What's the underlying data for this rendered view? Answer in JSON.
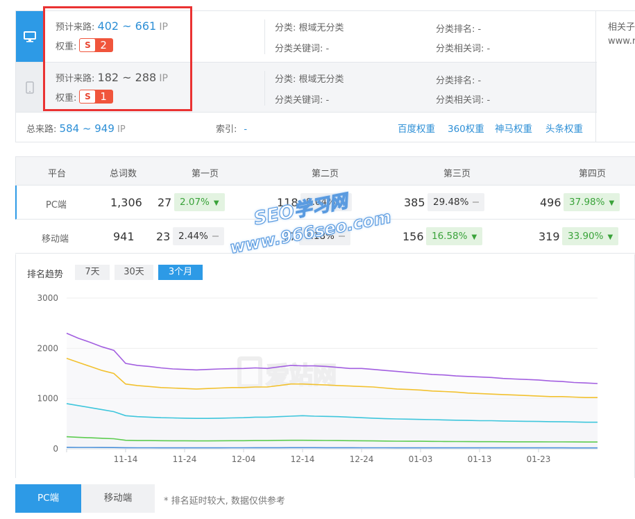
{
  "traffic": {
    "pc": {
      "estimate_label": "预计来路:",
      "range": "402 ~ 661",
      "unit": "IP",
      "weight_label": "权重:",
      "weight": "2",
      "category": "分类: 根域无分类",
      "category_keywords": "分类关键词: -",
      "category_rank": "分类排名: -",
      "category_related": "分类相关词: -"
    },
    "mobile": {
      "estimate_label": "预计来路:",
      "range": "182 ~ 288",
      "unit": "IP",
      "weight_label": "权重:",
      "weight": "1",
      "category": "分类: 根域无分类",
      "category_keywords": "分类关键词: -",
      "category_rank": "分类排名: -",
      "category_related": "分类相关词: -"
    },
    "total_label": "总来路:",
    "total_range": "584 ~ 949",
    "total_unit": "IP",
    "index_label": "索引:",
    "index_value": "-",
    "links": [
      "百度权重",
      "360权重",
      "神马权重",
      "头条权重"
    ],
    "side_label": "相关子",
    "side_value": "www.r"
  },
  "table": {
    "headers": [
      "平台",
      "总词数",
      "第一页",
      "第二页",
      "第三页",
      "第四页"
    ],
    "rows": [
      {
        "platform": "PC端",
        "total": "1,306",
        "pages": [
          {
            "count": "27",
            "pct": "2.07%",
            "trend": "down"
          },
          {
            "count": "118",
            "pct": "9.04%",
            "trend": "flat"
          },
          {
            "count": "385",
            "pct": "29.48%",
            "trend": "flat"
          },
          {
            "count": "496",
            "pct": "37.98%",
            "trend": "down"
          }
        ]
      },
      {
        "platform": "移动端",
        "total": "941",
        "pages": [
          {
            "count": "23",
            "pct": "2.44%",
            "trend": "flat"
          },
          {
            "count": "77",
            "pct": "8.18%",
            "trend": "flat"
          },
          {
            "count": "156",
            "pct": "16.58%",
            "trend": "down"
          },
          {
            "count": "319",
            "pct": "33.90%",
            "trend": "down"
          }
        ]
      }
    ]
  },
  "trend": {
    "title": "排名趋势",
    "ranges": [
      "7天",
      "30天",
      "3个月"
    ],
    "active_range": "3个月"
  },
  "watermark": {
    "line1": "SEO学习网",
    "line2": "www.966seo.com",
    "logo_text": "爱站网"
  },
  "bottom_tabs": [
    "PC端",
    "移动端"
  ],
  "note": "* 排名延时较大, 数据仅供参考",
  "colors": {
    "accent": "#2d9ae6",
    "badge": "#f0553c",
    "highlight_box": "#ea3232",
    "series": [
      "#a25ee0",
      "#f2c12e",
      "#3ec6dc",
      "#5ccc4f",
      "#4a90d9"
    ]
  },
  "chart_data": {
    "type": "line",
    "title": "",
    "xlabel": "",
    "ylabel": "",
    "ylim": [
      0,
      3000
    ],
    "yticks": [
      "0",
      "1000",
      "2000",
      "3000"
    ],
    "x_ticks": [
      "11-14",
      "11-24",
      "12-04",
      "12-14",
      "12-24",
      "01-03",
      "01-13",
      "01-23"
    ],
    "x": [
      "11-04",
      "11-06",
      "11-08",
      "11-10",
      "11-12",
      "11-14",
      "11-16",
      "11-18",
      "11-20",
      "11-22",
      "11-24",
      "11-26",
      "11-28",
      "11-30",
      "12-02",
      "12-04",
      "12-06",
      "12-08",
      "12-10",
      "12-12",
      "12-14",
      "12-16",
      "12-18",
      "12-20",
      "12-22",
      "12-24",
      "12-26",
      "12-28",
      "12-30",
      "01-01",
      "01-03",
      "01-05",
      "01-07",
      "01-09",
      "01-11",
      "01-13",
      "01-15",
      "01-17",
      "01-19",
      "01-21",
      "01-23",
      "01-25",
      "01-27",
      "01-29",
      "01-31",
      "02-02"
    ],
    "series": [
      {
        "values": [
          2300,
          2200,
          2120,
          2030,
          1960,
          1700,
          1660,
          1640,
          1610,
          1590,
          1580,
          1570,
          1580,
          1590,
          1595,
          1600,
          1610,
          1600,
          1630,
          1660,
          1650,
          1650,
          1640,
          1620,
          1600,
          1600,
          1580,
          1560,
          1540,
          1520,
          1500,
          1480,
          1470,
          1450,
          1440,
          1430,
          1420,
          1400,
          1390,
          1380,
          1370,
          1350,
          1340,
          1320,
          1310,
          1300
        ]
      },
      {
        "values": [
          1800,
          1720,
          1640,
          1560,
          1500,
          1290,
          1260,
          1240,
          1220,
          1210,
          1200,
          1190,
          1200,
          1210,
          1220,
          1220,
          1230,
          1230,
          1260,
          1290,
          1290,
          1280,
          1270,
          1260,
          1250,
          1240,
          1230,
          1210,
          1190,
          1180,
          1170,
          1150,
          1140,
          1130,
          1110,
          1100,
          1090,
          1080,
          1070,
          1060,
          1050,
          1040,
          1040,
          1030,
          1020,
          1020
        ]
      },
      {
        "values": [
          900,
          860,
          820,
          780,
          740,
          660,
          640,
          630,
          620,
          615,
          610,
          605,
          605,
          610,
          615,
          620,
          630,
          630,
          640,
          650,
          660,
          650,
          645,
          640,
          630,
          620,
          610,
          600,
          595,
          590,
          585,
          580,
          575,
          570,
          565,
          560,
          560,
          555,
          550,
          548,
          545,
          540,
          538,
          535,
          530,
          530
        ]
      },
      {
        "values": [
          240,
          230,
          220,
          210,
          200,
          170,
          165,
          165,
          162,
          160,
          160,
          158,
          158,
          160,
          162,
          162,
          165,
          165,
          168,
          170,
          170,
          168,
          166,
          165,
          162,
          160,
          158,
          155,
          152,
          150,
          150,
          148,
          146,
          145,
          144,
          143,
          142,
          141,
          140,
          140,
          139,
          138,
          138,
          137,
          136,
          135
        ]
      },
      {
        "values": [
          30,
          28,
          27,
          26,
          25,
          22,
          21,
          21,
          20,
          20,
          20,
          20,
          20,
          20,
          21,
          21,
          22,
          22,
          22,
          23,
          23,
          23,
          22,
          22,
          22,
          21,
          21,
          21,
          20,
          20,
          20,
          20,
          20,
          20,
          20,
          20,
          19,
          19,
          19,
          19,
          19,
          19,
          19,
          18,
          18,
          18
        ]
      }
    ]
  }
}
